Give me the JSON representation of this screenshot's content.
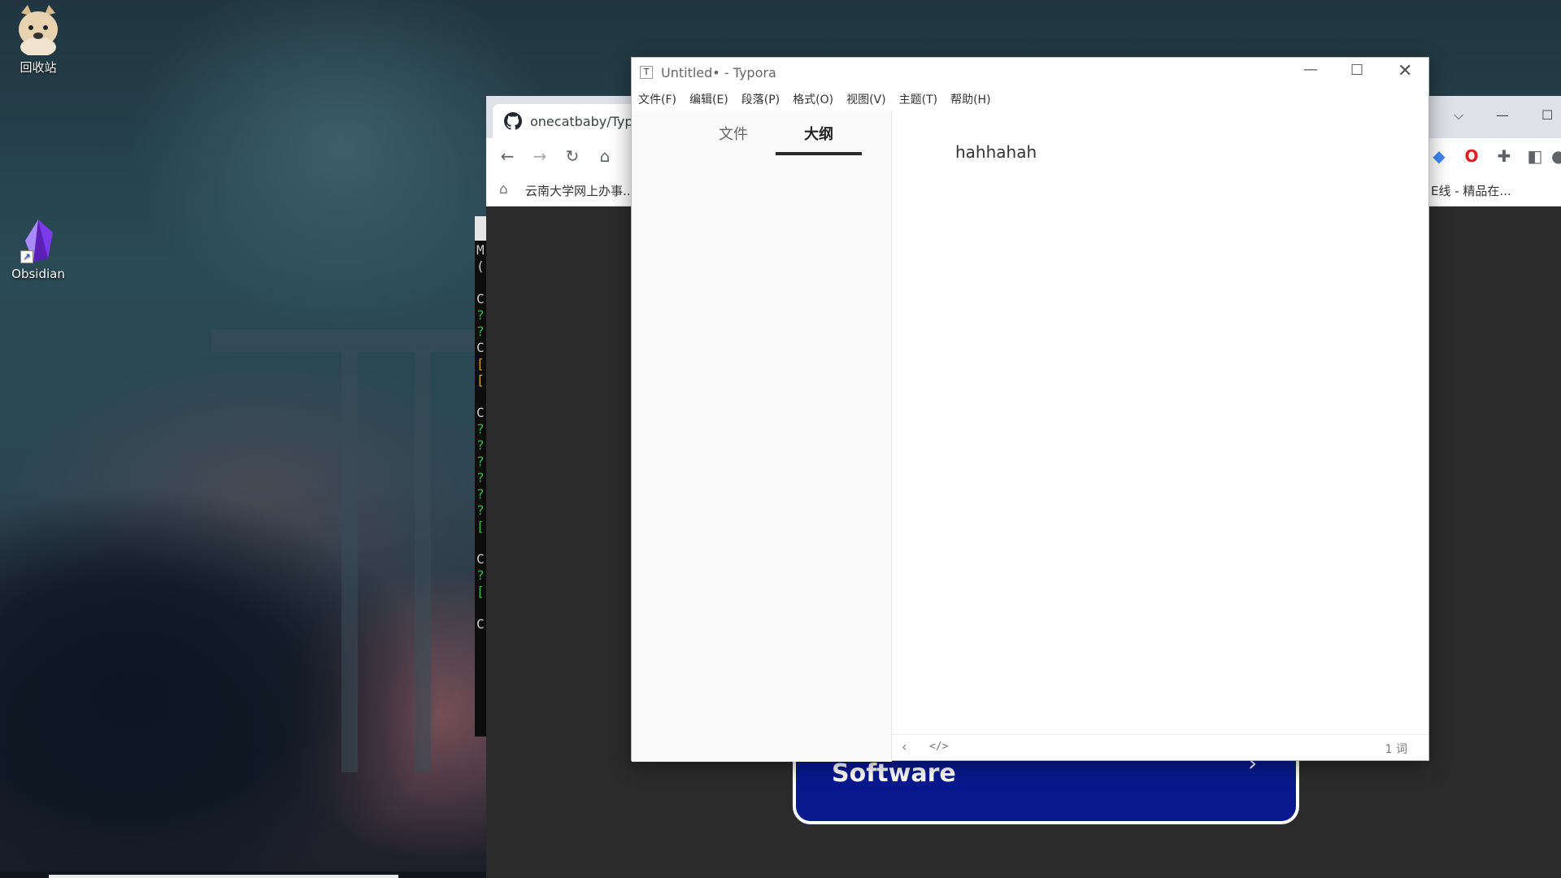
{
  "desktop": {
    "icons": [
      {
        "label": "回收站",
        "icon": "cat-recycle-bin-icon"
      },
      {
        "label": "Obsidian",
        "icon": "obsidian-icon"
      }
    ]
  },
  "browser": {
    "tab_title": "onecatbaby/Typo",
    "bookmarks": {
      "left": "云南大学网上办事...",
      "right": "E线 - 精品在..."
    }
  },
  "terminal": {
    "lines": [
      "M",
      "(",
      "",
      "C",
      "?",
      "?",
      "C",
      "[",
      "[",
      "",
      "C",
      "?",
      "?",
      "?",
      "?",
      "?",
      "?",
      "[",
      "",
      "C",
      "?",
      "[",
      "",
      "C"
    ]
  },
  "banner": {
    "text": "Software"
  },
  "typora": {
    "title": "Untitled• - Typora",
    "app_icon_letter": "T",
    "menu": [
      "文件(F)",
      "编辑(E)",
      "段落(P)",
      "格式(O)",
      "视图(V)",
      "主题(T)",
      "帮助(H)"
    ],
    "sidebar_tabs": {
      "files": "文件",
      "outline": "大纲"
    },
    "active_sidebar_tab": "outline",
    "content": "hahhahah",
    "status": {
      "word_count": "1 词"
    }
  },
  "colors": {
    "banner_bg": "#08198f",
    "terminal_bg": "#0c0c0c",
    "sidebar_bg": "#fafafa"
  }
}
